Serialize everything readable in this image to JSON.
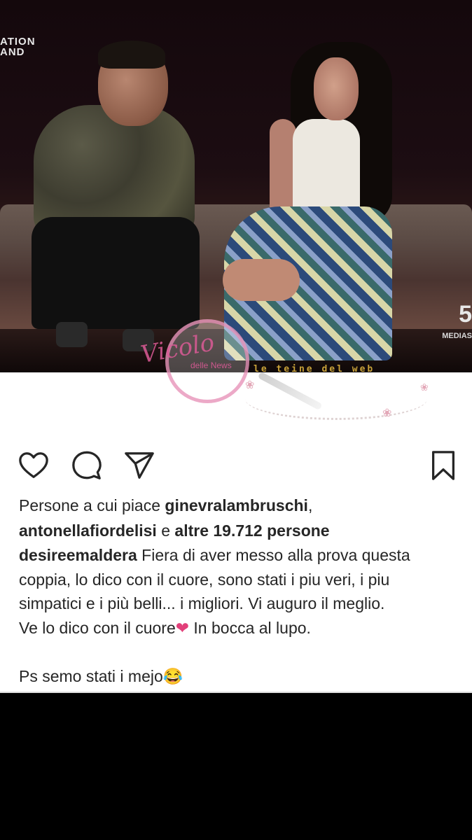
{
  "photo": {
    "tv_logo_line1": "ATION",
    "tv_logo_line2": "AND",
    "channel_logo": "5",
    "channel_sub": "MEDIAS",
    "watermark_main": "Vicolo",
    "watermark_sub": "delle",
    "watermark_news": "News",
    "watermark_band": "le teine del web"
  },
  "actions": {
    "like_icon": "heart-outline-icon",
    "comment_icon": "comment-bubble-icon",
    "share_icon": "paper-plane-icon",
    "save_icon": "bookmark-icon"
  },
  "likes": {
    "prefix": "Persone a cui piace ",
    "user1": "ginevralambruschi",
    "sep": ",",
    "user2": "antonellafiordelisi",
    "connector": " e ",
    "others": "altre 19.712 persone"
  },
  "caption": {
    "author": "desireemaldera",
    "line1": " Fiera di aver messo alla prova questa",
    "line2": "coppia, lo dico con il cuore, sono stati i piu veri, i piu",
    "line3": "simpatici e i più belli... i migliori. Vi auguro il meglio.",
    "line4a": "Ve lo dico con il cuore",
    "heart": "❤",
    "line4b": " In bocca al lupo.",
    "line5": "Ps semo stati i mejo",
    "emoji": "😂"
  }
}
